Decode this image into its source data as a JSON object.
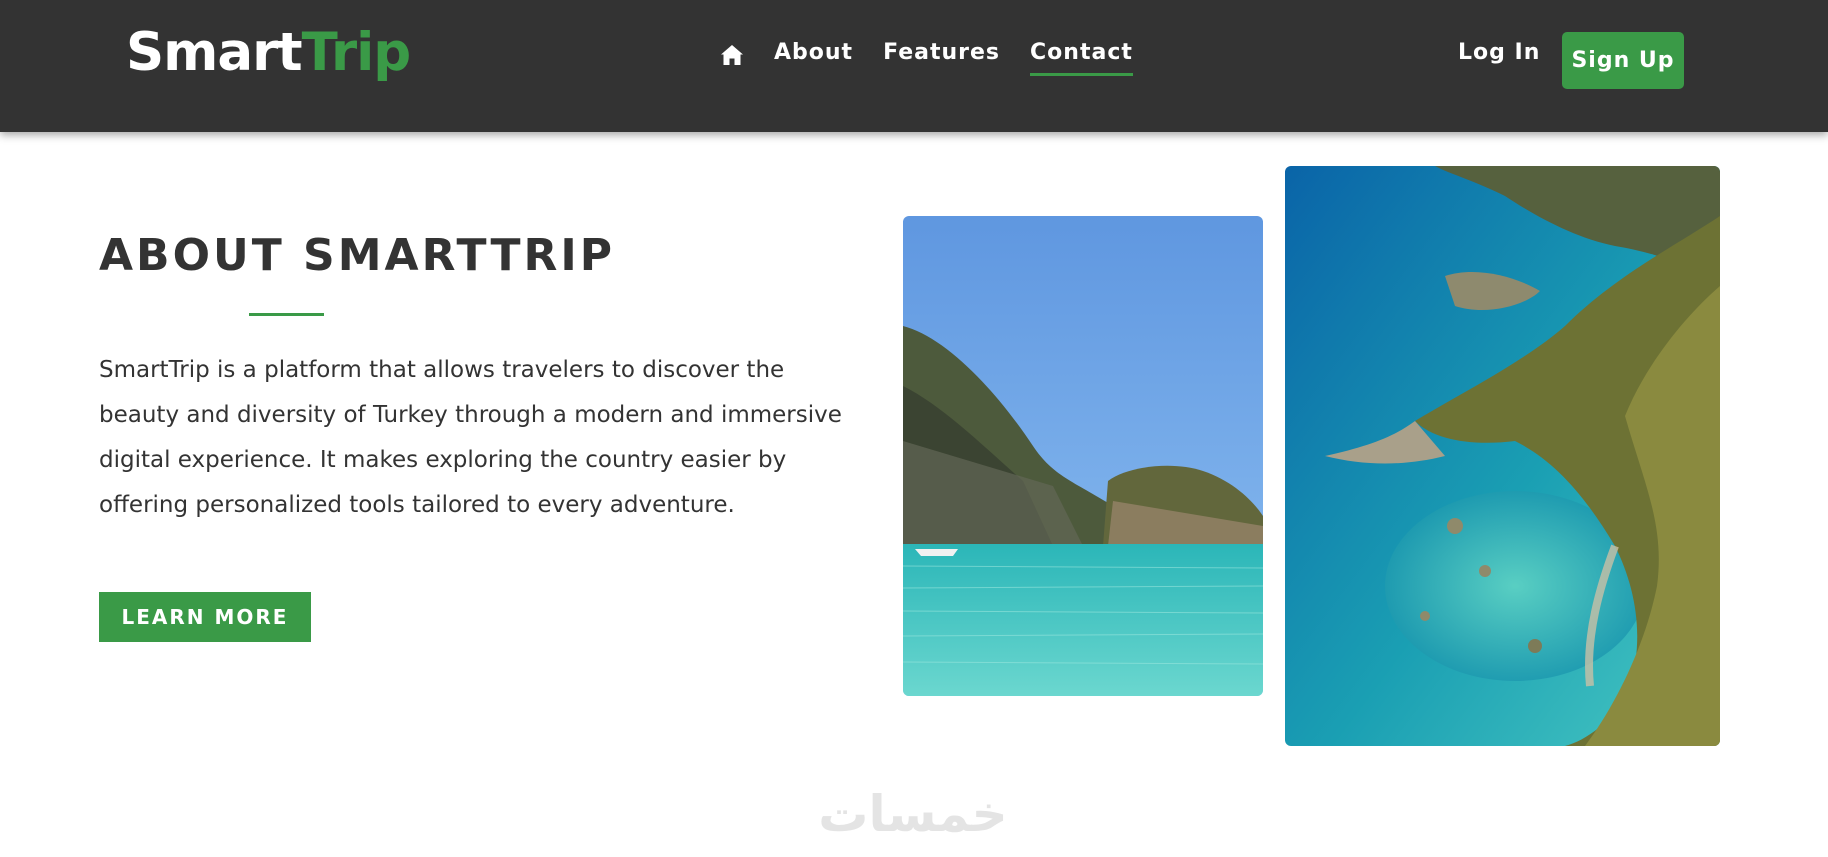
{
  "nav": {
    "logo": {
      "part1": "Smart",
      "part2": "Trip"
    },
    "home_icon": "home-icon",
    "links": [
      {
        "label": "About",
        "active": false
      },
      {
        "label": "Features",
        "active": false
      },
      {
        "label": "Contact",
        "active": true
      }
    ],
    "login_label": "Log In",
    "signup_label": "Sign Up"
  },
  "about": {
    "title": "ABOUT SMARTTRIP",
    "text": "SmartTrip is a platform that allows travelers to discover the beauty and diversity of Turkey through a modern and immersive digital experience. It makes exploring the country easier by offering personalized tools tailored to every adventure.",
    "button_label": "LEARN MORE"
  },
  "images": [
    {
      "name": "bay-photo",
      "alt": ""
    },
    {
      "name": "coastline-photo",
      "alt": ""
    }
  ],
  "watermark": {
    "text": "خمسات"
  },
  "colors": {
    "nav_bg": "#333333",
    "accent": "#3a9a47",
    "text": "#333333",
    "background": "#ffffff"
  }
}
